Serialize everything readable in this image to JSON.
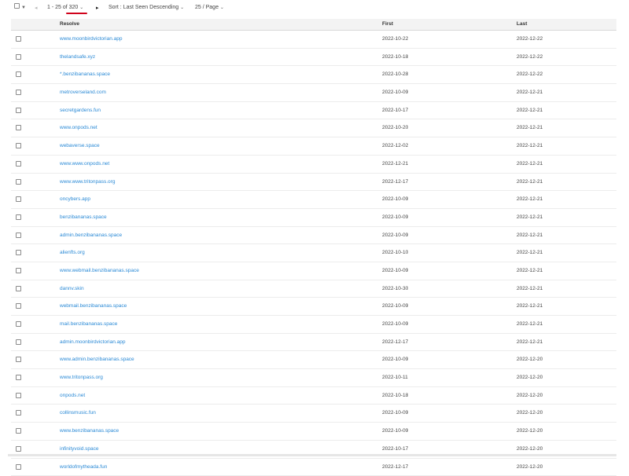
{
  "toolbar": {
    "range": "1 - 25 of",
    "total": "320",
    "sort_label": "Sort : Last Seen Descending",
    "page_size": "25 / Page"
  },
  "columns": {
    "resolve": "Resolve",
    "first": "First",
    "last": "Last"
  },
  "rows": [
    {
      "resolve": "www.moonbirdvictorian.app",
      "first": "2022-10-22",
      "last": "2022-12-22"
    },
    {
      "resolve": "thelandsafe.xyz",
      "first": "2022-10-18",
      "last": "2022-12-22"
    },
    {
      "resolve": "*.benzibananas.space",
      "first": "2022-10-28",
      "last": "2022-12-22"
    },
    {
      "resolve": "metroverseland.com",
      "first": "2022-10-09",
      "last": "2022-12-21"
    },
    {
      "resolve": "secretgardens.fun",
      "first": "2022-10-17",
      "last": "2022-12-21"
    },
    {
      "resolve": "www.onpods.net",
      "first": "2022-10-20",
      "last": "2022-12-21"
    },
    {
      "resolve": "webaverse.space",
      "first": "2022-12-02",
      "last": "2022-12-21"
    },
    {
      "resolve": "www.www.onpods.net",
      "first": "2022-12-21",
      "last": "2022-12-21"
    },
    {
      "resolve": "www.www.tritonpass.org",
      "first": "2022-12-17",
      "last": "2022-12-21"
    },
    {
      "resolve": "oncybers.app",
      "first": "2022-10-09",
      "last": "2022-12-21"
    },
    {
      "resolve": "benzibananas.space",
      "first": "2022-10-09",
      "last": "2022-12-21"
    },
    {
      "resolve": "admin.benzibananas.space",
      "first": "2022-10-09",
      "last": "2022-12-21"
    },
    {
      "resolve": "alienfts.org",
      "first": "2022-10-10",
      "last": "2022-12-21"
    },
    {
      "resolve": "www.webmail.benzibananas.space",
      "first": "2022-10-09",
      "last": "2022-12-21"
    },
    {
      "resolve": "dannv.skin",
      "first": "2022-10-30",
      "last": "2022-12-21"
    },
    {
      "resolve": "webmail.benzibananas.space",
      "first": "2022-10-09",
      "last": "2022-12-21"
    },
    {
      "resolve": "mail.benzibananas.space",
      "first": "2022-10-09",
      "last": "2022-12-21"
    },
    {
      "resolve": "admin.moonbirdvictorian.app",
      "first": "2022-12-17",
      "last": "2022-12-21"
    },
    {
      "resolve": "www.admin.benzibananas.space",
      "first": "2022-10-09",
      "last": "2022-12-20"
    },
    {
      "resolve": "www.tritonpass.org",
      "first": "2022-10-11",
      "last": "2022-12-20"
    },
    {
      "resolve": "onpods.net",
      "first": "2022-10-18",
      "last": "2022-12-20"
    },
    {
      "resolve": "collinsmusic.fun",
      "first": "2022-10-09",
      "last": "2022-12-20"
    },
    {
      "resolve": "www.benzibananas.space",
      "first": "2022-10-09",
      "last": "2022-12-20"
    },
    {
      "resolve": "infinityvoid.space",
      "first": "2022-10-17",
      "last": "2022-12-20"
    },
    {
      "resolve": "worldofmytheada.fun",
      "first": "2022-12-17",
      "last": "2022-12-20"
    }
  ]
}
